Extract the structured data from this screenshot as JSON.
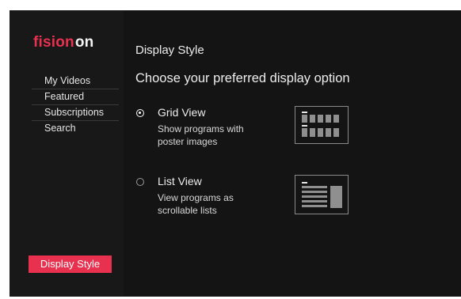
{
  "brand": {
    "name_part1": "fision",
    "name_part2": "on",
    "color": "#e8304f"
  },
  "sidebar": {
    "items": [
      {
        "label": "My Videos"
      },
      {
        "label": "Featured"
      },
      {
        "label": "Subscriptions"
      },
      {
        "label": "Search"
      }
    ],
    "active_item": {
      "label": "Display Style"
    }
  },
  "main": {
    "title": "Display Style",
    "subtitle": "Choose your preferred display option",
    "options": [
      {
        "title": "Grid View",
        "description": "Show programs with poster images",
        "selected": true,
        "preview_icon": "grid-view-preview-icon"
      },
      {
        "title": "List View",
        "description": "View programs as scrollable lists",
        "selected": false,
        "preview_icon": "list-view-preview-icon"
      }
    ]
  }
}
